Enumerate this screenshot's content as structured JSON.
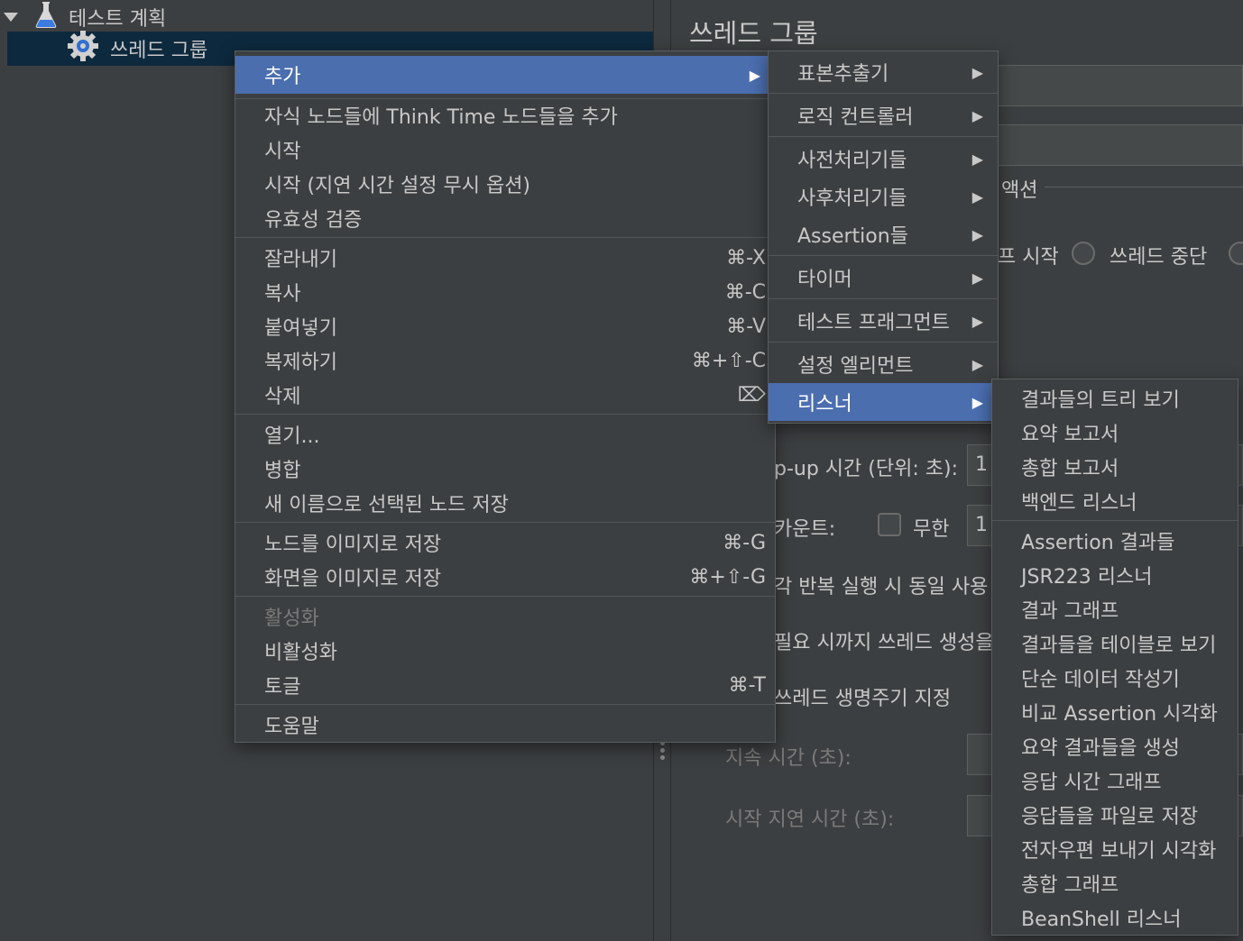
{
  "tree": {
    "root_label": "테스트 계획",
    "child_label": "쓰레드 그룹"
  },
  "panel": {
    "title": "쓰레드 그룹",
    "action_label": "액션",
    "start_next_frag": "프 시작",
    "stop_thread": "쓰레드 중단",
    "rampup_label": "p-up 시간 (단위: 초):",
    "rampup_value": "1",
    "loop_label": "카운트:",
    "infinite_label": "무한",
    "loop_value": "1",
    "same_user_label": "각 반복 실행 시 동일 사용",
    "delay_create_label": "필요 시까지 쓰레드 생성을",
    "lifetime_label": "쓰레드 생명주기 지정",
    "duration_label": "지속 시간 (초):",
    "startup_delay_label": "시작 지연 시간 (초):"
  },
  "context_menu": {
    "groups": [
      [
        {
          "label": "추가",
          "submenu": true,
          "highlighted": true
        }
      ],
      [
        {
          "label": "자식 노드들에 Think Time 노드들을 추가"
        },
        {
          "label": "시작"
        },
        {
          "label": "시작 (지연 시간 설정 무시 옵션)"
        },
        {
          "label": "유효성 검증"
        }
      ],
      [
        {
          "label": "잘라내기",
          "shortcut": "⌘-X"
        },
        {
          "label": "복사",
          "shortcut": "⌘-C"
        },
        {
          "label": "붙여넣기",
          "shortcut": "⌘-V"
        },
        {
          "label": "복제하기",
          "shortcut": "⌘+⇧-C"
        },
        {
          "label": "삭제",
          "shortcut": "⌦"
        }
      ],
      [
        {
          "label": "열기..."
        },
        {
          "label": "병합"
        },
        {
          "label": "새 이름으로 선택된 노드 저장"
        }
      ],
      [
        {
          "label": "노드를 이미지로 저장",
          "shortcut": "⌘-G"
        },
        {
          "label": "화면을 이미지로 저장",
          "shortcut": "⌘+⇧-G"
        }
      ],
      [
        {
          "label": "활성화",
          "disabled": true
        },
        {
          "label": "비활성화"
        },
        {
          "label": "토글",
          "shortcut": "⌘-T"
        }
      ],
      [
        {
          "label": "도움말"
        }
      ]
    ]
  },
  "add_submenu": {
    "groups": [
      [
        {
          "label": "표본추출기"
        }
      ],
      [
        {
          "label": "로직 컨트롤러"
        }
      ],
      [
        {
          "label": "사전처리기들"
        },
        {
          "label": "사후처리기들"
        },
        {
          "label": "Assertion들"
        }
      ],
      [
        {
          "label": "타이머"
        }
      ],
      [
        {
          "label": "테스트 프래그먼트"
        }
      ],
      [
        {
          "label": "설정 엘리먼트"
        },
        {
          "label": "리스너",
          "highlighted": true
        }
      ]
    ]
  },
  "listener_submenu": {
    "groups": [
      [
        "결과들의 트리 보기",
        "요약 보고서",
        "총합 보고서",
        "백엔드 리스너"
      ],
      [
        "Assertion 결과들",
        "JSR223 리스너",
        "결과 그래프",
        "결과들을 테이블로 보기",
        "단순 데이터 작성기",
        "비교 Assertion 시각화",
        "요약 결과들을 생성",
        "응답 시간 그래프",
        "응답들을 파일로 저장",
        "전자우편 보내기 시각화",
        "총합 그래프",
        "BeanShell 리스너"
      ]
    ]
  },
  "colors": {
    "background": "#3c3f41",
    "highlight": "#4b6eaf",
    "tree_selection": "#0d293e",
    "text": "#c8c8c8",
    "disabled_text": "#7a7a7a"
  }
}
